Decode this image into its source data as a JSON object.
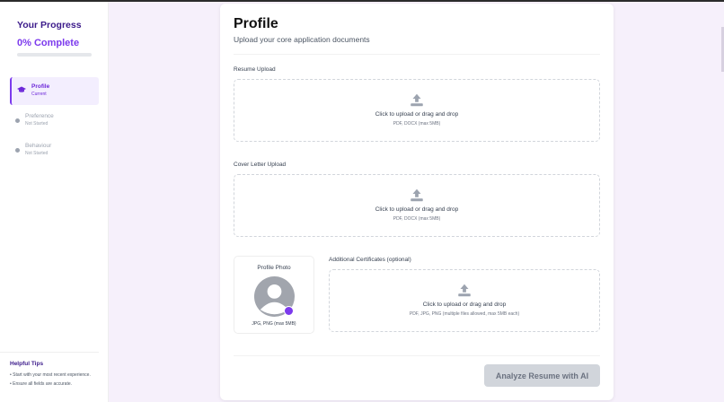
{
  "sidebar": {
    "progress_title": "Your Progress",
    "progress_text": "0% Complete",
    "progress_fraction": 0,
    "steps": [
      {
        "name": "Profile",
        "status": "Current",
        "active": true
      },
      {
        "name": "Preference",
        "status": "Not Started",
        "active": false
      },
      {
        "name": "Behaviour",
        "status": "Not Started",
        "active": false
      }
    ],
    "tips_title": "Helpful Tips",
    "tips": [
      "Start with your most recent experience.",
      "Ensure all fields are accurate."
    ]
  },
  "main": {
    "title": "Profile",
    "subtitle": "Upload your core application documents",
    "resume": {
      "label": "Resume Upload",
      "prompt": "Click to upload or drag and drop",
      "hint": "PDF, DOCX (max 5MB)"
    },
    "cover_letter": {
      "label": "Cover Letter Upload",
      "prompt": "Click to upload or drag and drop",
      "hint": "PDF, DOCX (max 5MB)"
    },
    "photo": {
      "label": "Profile Photo",
      "hint": "JPG, PNG (max 5MB)"
    },
    "certificates": {
      "label": "Additional Certificates (optional)",
      "prompt": "Click to upload or drag and drop",
      "hint": "PDF, JPG, PNG (multiple files allowed, max 5MB each)"
    },
    "analyze_button": "Analyze Resume with AI"
  },
  "colors": {
    "accent": "#7c3aed",
    "background": "#f6f0fb",
    "button_disabled": "#d1d5db"
  },
  "icons": {
    "upload": "upload-icon",
    "step_active": "graduation-cap-icon",
    "avatar": "user-avatar-icon",
    "camera": "camera-icon"
  }
}
